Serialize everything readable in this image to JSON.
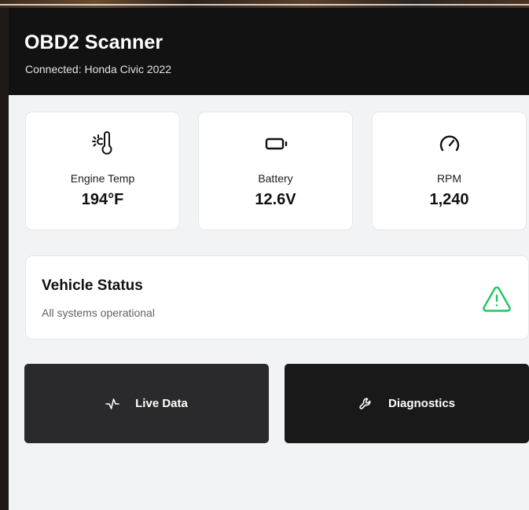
{
  "header": {
    "title": "OBD2 Scanner",
    "subtitle": "Connected: Honda Civic 2022"
  },
  "stats": [
    {
      "label": "Engine Temp",
      "value": "194°F",
      "icon": "thermometer-icon"
    },
    {
      "label": "Battery",
      "value": "12.6V",
      "icon": "battery-icon"
    },
    {
      "label": "RPM",
      "value": "1,240",
      "icon": "gauge-icon"
    }
  ],
  "status": {
    "title": "Vehicle Status",
    "text": "All systems operational",
    "icon": "warning-triangle-icon",
    "icon_color": "#22c55e"
  },
  "actions": {
    "live_data": {
      "label": "Live Data",
      "icon": "activity-icon"
    },
    "diagnostics": {
      "label": "Diagnostics",
      "icon": "wrench-icon"
    }
  },
  "colors": {
    "header_bg": "#121212",
    "app_bg": "#f2f3f5",
    "card_bg": "#ffffff",
    "live_button_bg": "#2a2a2c",
    "diagnostics_button_bg": "#19191a"
  }
}
